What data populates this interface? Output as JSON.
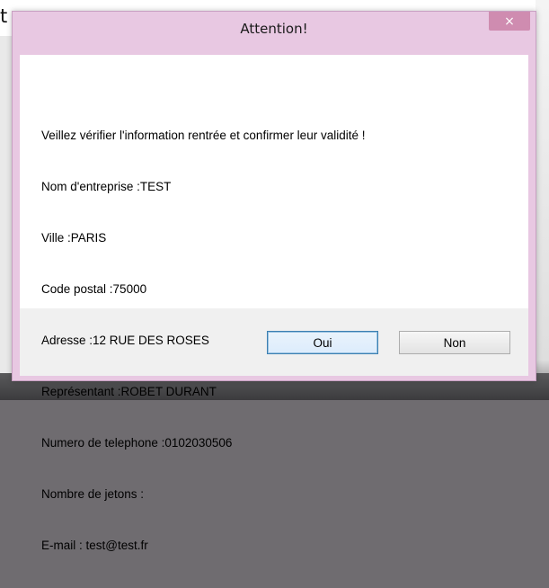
{
  "background_window": {
    "title_fragment": "t"
  },
  "dialog": {
    "title": "Attention!",
    "close_glyph": "×",
    "message_lines": [
      "Veillez vérifier l'information rentrée et confirmer leur validité !",
      "Nom d'entreprise :TEST",
      "Ville :PARIS",
      "Code postal :75000",
      "Adresse :12 RUE DES ROSES",
      "Représentant :ROBET DURANT",
      "Numero de telephone :0102030506",
      "Nombre de jetons :",
      "E-mail : test@test.fr"
    ],
    "buttons": {
      "yes_label": "Oui",
      "no_label": "Non"
    },
    "colors": {
      "frame": "#e8c8e2",
      "close_button": "#cf8cb0",
      "default_button_border": "#3c7fb1"
    }
  }
}
